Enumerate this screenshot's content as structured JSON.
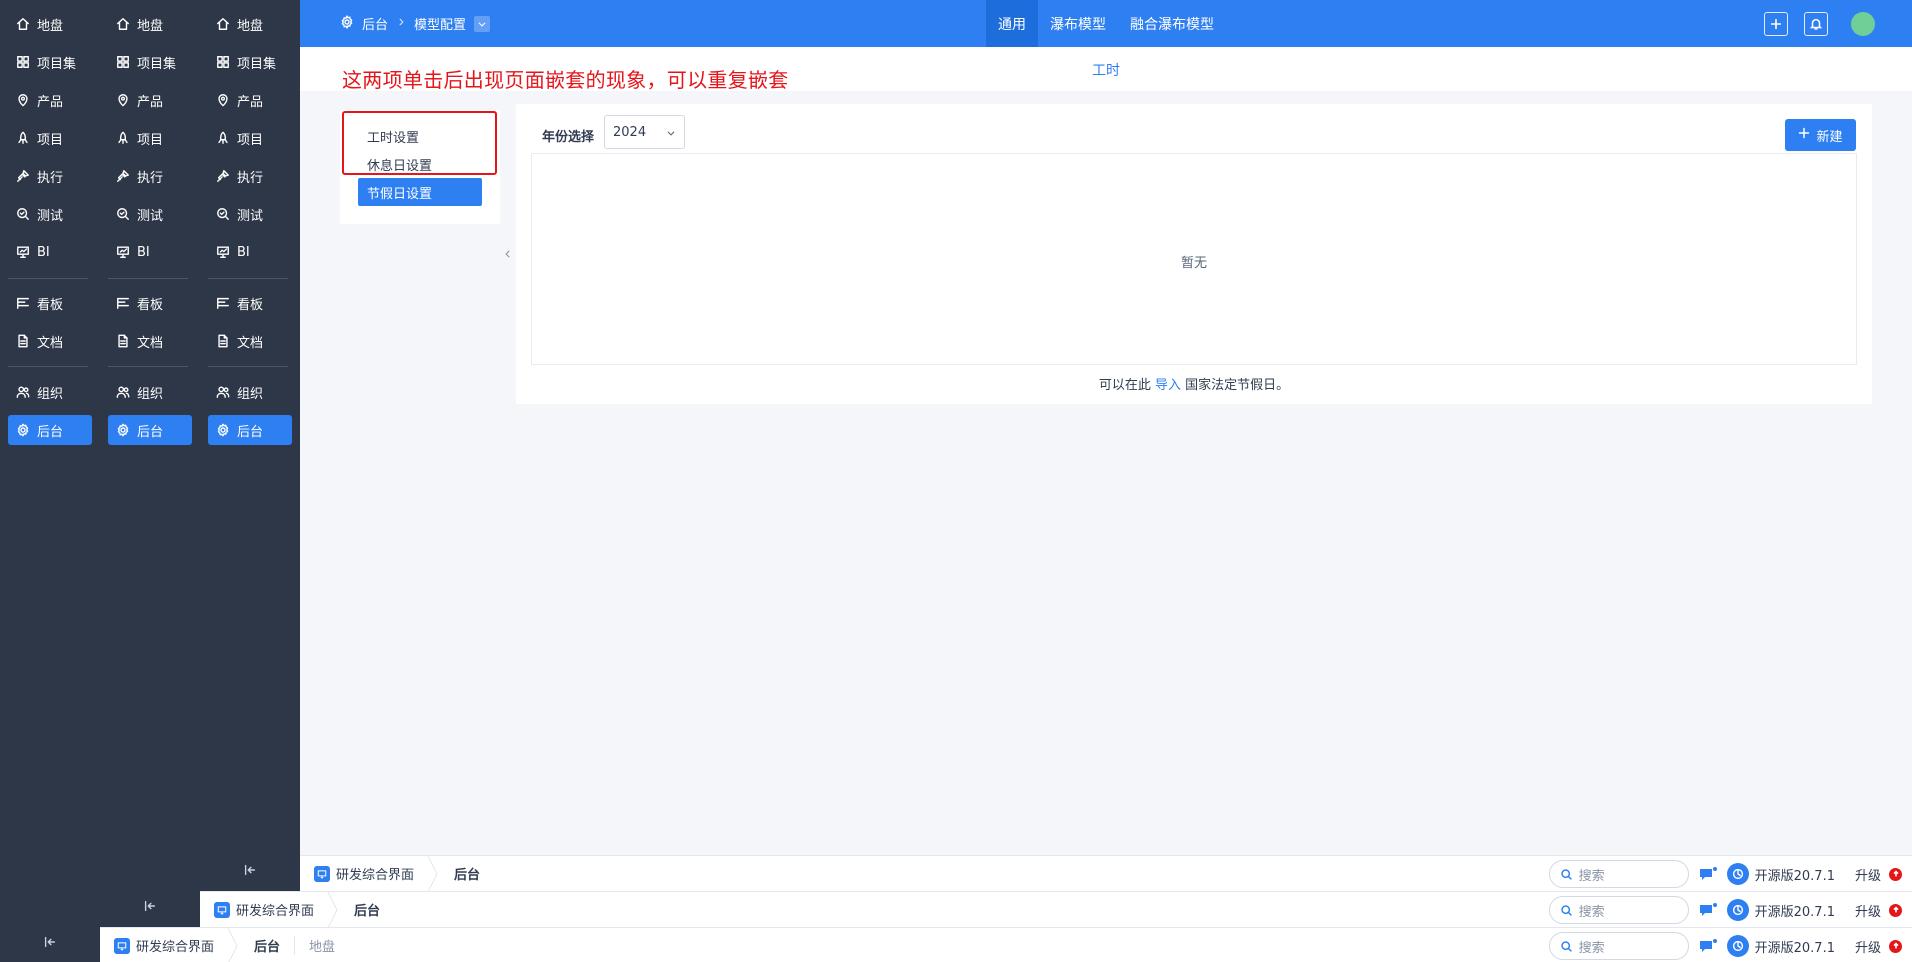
{
  "sidebar": {
    "items": [
      {
        "label": "地盘",
        "icon": "home-icon"
      },
      {
        "label": "项目集",
        "icon": "grid-icon"
      },
      {
        "label": "产品",
        "icon": "lightbulb-icon"
      },
      {
        "label": "项目",
        "icon": "rocket-icon"
      },
      {
        "label": "执行",
        "icon": "run-icon"
      },
      {
        "label": "测试",
        "icon": "search-check-icon"
      },
      {
        "label": "BI",
        "icon": "presentation-icon"
      },
      {
        "label": "看板",
        "icon": "kanban-icon"
      },
      {
        "label": "文档",
        "icon": "doc-icon"
      },
      {
        "label": "组织",
        "icon": "users-icon"
      },
      {
        "label": "后台",
        "icon": "gear-icon",
        "active": true
      }
    ]
  },
  "header": {
    "breadcrumb_root": "后台",
    "breadcrumb_current": "模型配置",
    "tabs": [
      {
        "label": "通用",
        "active": true
      },
      {
        "label": "瀑布模型"
      },
      {
        "label": "融合瀑布模型"
      }
    ]
  },
  "subheader": {
    "tab": "工时"
  },
  "annotation": "这两项单击后出现页面嵌套的现象，可以重复嵌套",
  "settings_menu": {
    "items": [
      {
        "label": "工时设置"
      },
      {
        "label": "休息日设置"
      },
      {
        "label": "节假日设置",
        "active": true
      }
    ]
  },
  "main": {
    "year_label": "年份选择",
    "year_value": "2024",
    "new_button": "新建",
    "empty_text": "暂无",
    "hint_before": "可以在此",
    "hint_link": "导入",
    "hint_after": "国家法定节假日。"
  },
  "bottom_bar": {
    "app_name": "研发综合界面",
    "current": "后台",
    "extra": "地盘",
    "search_placeholder": "搜索",
    "version": "开源版20.7.1",
    "upgrade": "升级"
  },
  "colors": {
    "primary": "#2e7ff2",
    "sidebar_bg": "#2e3748",
    "annotation_red": "#e5161b"
  }
}
